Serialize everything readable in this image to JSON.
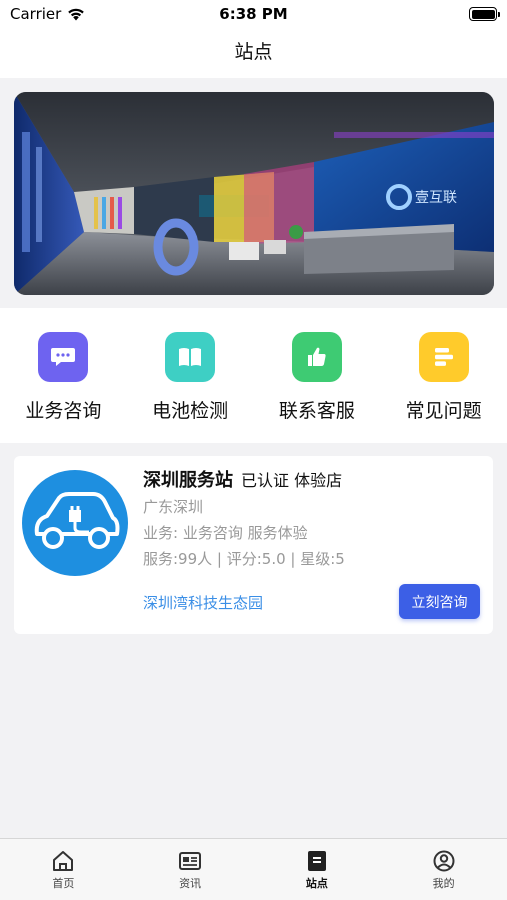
{
  "status_bar": {
    "carrier": "Carrier",
    "time": "6:38 PM"
  },
  "nav": {
    "title": "站点"
  },
  "quick_menu": [
    {
      "label": "业务咨询",
      "icon": "chat-bubble-icon",
      "color": "#6e63f0"
    },
    {
      "label": "电池检测",
      "icon": "book-icon",
      "color": "#3ecfc4"
    },
    {
      "label": "联系客服",
      "icon": "thumbs-up-icon",
      "color": "#3ecb73"
    },
    {
      "label": "常见问题",
      "icon": "list-icon",
      "color": "#ffcb2b"
    }
  ],
  "station": {
    "name": "深圳服务站",
    "tags": "已认证 体验店",
    "region": "广东深圳",
    "business": "业务: 业务咨询 服务体验",
    "stats": "服务:99人 | 评分:5.0 | 星级:5",
    "location": "深圳湾科技生态园",
    "button_label": "立刻咨询"
  },
  "banner": {
    "logo_text": "壹互联"
  },
  "tabs": [
    {
      "label": "首页",
      "icon": "home-icon",
      "active": false
    },
    {
      "label": "资讯",
      "icon": "news-icon",
      "active": false
    },
    {
      "label": "站点",
      "icon": "station-icon",
      "active": true
    },
    {
      "label": "我的",
      "icon": "user-icon",
      "active": false
    }
  ]
}
